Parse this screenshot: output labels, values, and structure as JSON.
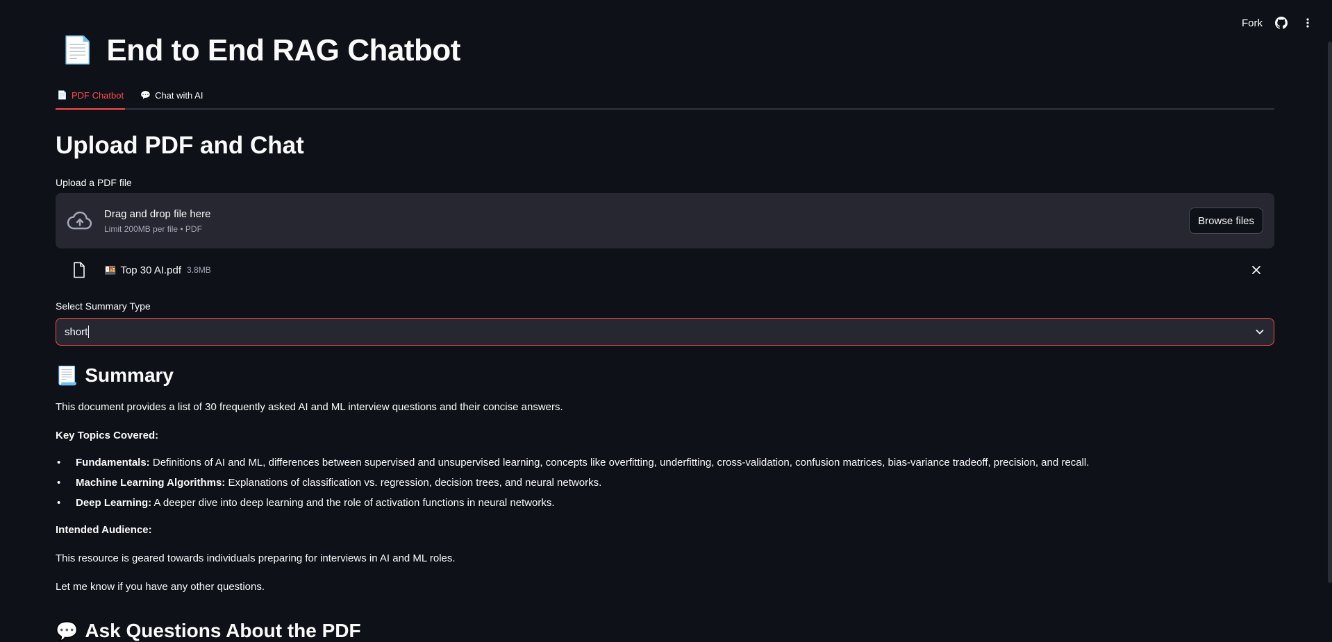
{
  "topbar": {
    "fork_label": "Fork"
  },
  "app": {
    "title_emoji": "📄",
    "title": "End to End RAG Chatbot"
  },
  "tabs": [
    {
      "icon": "📄",
      "label": "PDF Chatbot"
    },
    {
      "icon": "💬",
      "label": "Chat with AI"
    }
  ],
  "upload": {
    "section_title": "Upload PDF and Chat",
    "label": "Upload a PDF file",
    "drop_text": "Drag and drop file here",
    "limit_text": "Limit 200MB per file • PDF",
    "browse_label": "Browse files",
    "file": {
      "emoji": "🍱",
      "name": "Top 30 AI.pdf",
      "size": "3.8MB"
    }
  },
  "summary_type": {
    "label": "Select Summary Type",
    "value": "short"
  },
  "summary": {
    "emoji": "📃",
    "heading": "Summary",
    "intro": "This document provides a list of 30 frequently asked AI and ML interview questions and their concise answers.",
    "topics_heading": "Key Topics Covered:",
    "topics": [
      {
        "title": "Fundamentals:",
        "text": " Definitions of AI and ML, differences between supervised and unsupervised learning, concepts like overfitting, underfitting, cross-validation, confusion matrices, bias-variance tradeoff, precision, and recall."
      },
      {
        "title": "Machine Learning Algorithms:",
        "text": " Explanations of classification vs. regression, decision trees, and neural networks."
      },
      {
        "title": "Deep Learning:",
        "text": " A deeper dive into deep learning and the role of activation functions in neural networks."
      }
    ],
    "audience_heading": "Intended Audience:",
    "audience_text": "This resource is geared towards individuals preparing for interviews in AI and ML roles.",
    "closing": "Let me know if you have any other questions."
  },
  "ask": {
    "emoji": "💬",
    "heading": "Ask Questions About the PDF"
  },
  "colors": {
    "background": "#0e1117",
    "accent": "#ff4b4b",
    "surface": "#262730",
    "muted": "#a3a8b8"
  }
}
